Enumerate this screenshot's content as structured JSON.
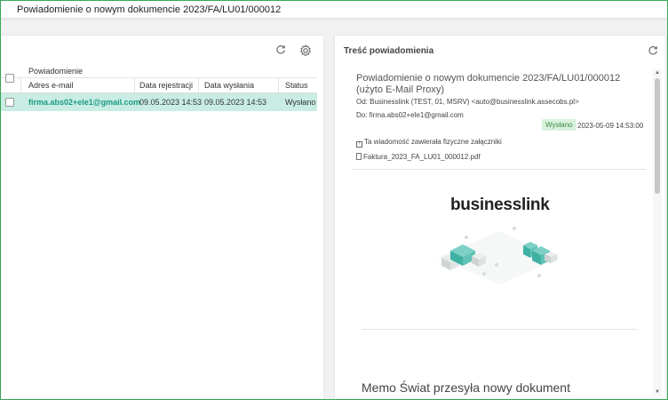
{
  "window": {
    "title": "Powiadomienie o nowym dokumencie 2023/FA/LU01/000012"
  },
  "left_panel": {
    "icons": [
      "refresh-icon",
      "settings-icon"
    ],
    "table": {
      "group_header": "Powiadomienie",
      "columns": [
        "Adres e-mail",
        "Data rejestracji",
        "Data wysłania",
        "Status"
      ],
      "rows": [
        {
          "email": "firma.abs02+ele1@gmail.com",
          "registered": "09.05.2023 14:53",
          "sent": "09.05.2023 14:53",
          "status": "Wysłano",
          "selected": true
        }
      ]
    }
  },
  "right_panel": {
    "title": "Treść powiadomienia",
    "icons": [
      "refresh-icon"
    ],
    "message": {
      "subject": "Powiadomienie o nowym dokumencie 2023/FA/LU01/000012 (użyto E-Mail Proxy)",
      "from": "Od: Businesslink (TEST, 01, MSRV) <auto@businesslink.assecobs.pl>",
      "to": "Do: firma.abs02+ele1@gmail.com",
      "status_badge": "Wysłano",
      "sent_datetime": "2023-05-09 14:53:00",
      "attachments_note": "Ta wiadomość zawierała fizyczne załączniki",
      "attachment_name": "Faktura_2023_FA_LU01_000012.pdf"
    },
    "body": {
      "logo_text": "businesslink",
      "heading": "Memo Świat przesyła nowy dokument"
    }
  },
  "colors": {
    "frame_border": "#3aa95a",
    "selected_row": "#c9ede4",
    "email_link": "#1a9a80",
    "badge_bg": "#d9f2dd",
    "badge_text": "#3c8a4b",
    "illustration_teal": "#3fb1a4"
  }
}
